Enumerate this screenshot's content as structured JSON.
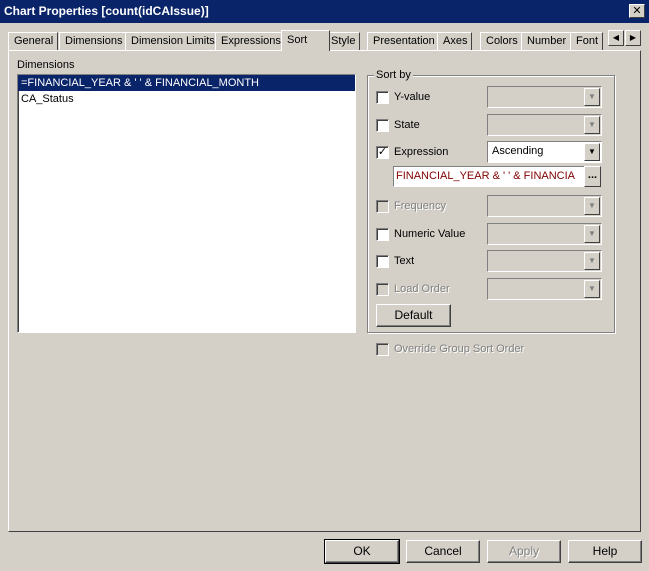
{
  "window": {
    "title": "Chart Properties [count(idCAIssue)]",
    "close_glyph": "✕"
  },
  "tabs": [
    {
      "label": "General",
      "active": false
    },
    {
      "label": "Dimensions",
      "active": false
    },
    {
      "label": "Dimension Limits",
      "active": false
    },
    {
      "label": "Expressions",
      "active": false
    },
    {
      "label": "Sort",
      "active": true
    },
    {
      "label": "Style",
      "active": false
    },
    {
      "label": "Presentation",
      "active": false
    },
    {
      "label": "Axes",
      "active": false
    },
    {
      "label": "Colors",
      "active": false
    },
    {
      "label": "Number",
      "active": false
    },
    {
      "label": "Font",
      "active": false
    }
  ],
  "tab_scroll": {
    "left_glyph": "◀",
    "right_glyph": "▶"
  },
  "dimensions": {
    "label": "Dimensions",
    "items": [
      {
        "label": "=FINANCIAL_YEAR & ' ' & FINANCIAL_MONTH",
        "selected": true
      },
      {
        "label": "CA_Status",
        "selected": false
      }
    ]
  },
  "sort_by": {
    "title": "Sort by",
    "options": {
      "y_value": {
        "label": "Y-value",
        "checked": false,
        "enabled": true
      },
      "state": {
        "label": "State",
        "checked": false,
        "enabled": true
      },
      "expression": {
        "label": "Expression",
        "checked": true,
        "enabled": true,
        "order": "Ascending",
        "value": "FINANCIAL_YEAR & ' ' & FINANCIA"
      },
      "frequency": {
        "label": "Frequency",
        "checked": false,
        "enabled": false
      },
      "numeric_value": {
        "label": "Numeric Value",
        "checked": false,
        "enabled": true
      },
      "text": {
        "label": "Text",
        "checked": false,
        "enabled": true
      },
      "load_order": {
        "label": "Load Order",
        "checked": false,
        "enabled": false
      }
    },
    "default_button": "Default",
    "expr_button": "..."
  },
  "override_group": {
    "label": "Override Group Sort Order",
    "checked": false,
    "enabled": false
  },
  "check_mark": "✓",
  "combo_arrow": "▼",
  "footer": {
    "ok": "OK",
    "cancel": "Cancel",
    "apply": "Apply",
    "help": "Help"
  }
}
